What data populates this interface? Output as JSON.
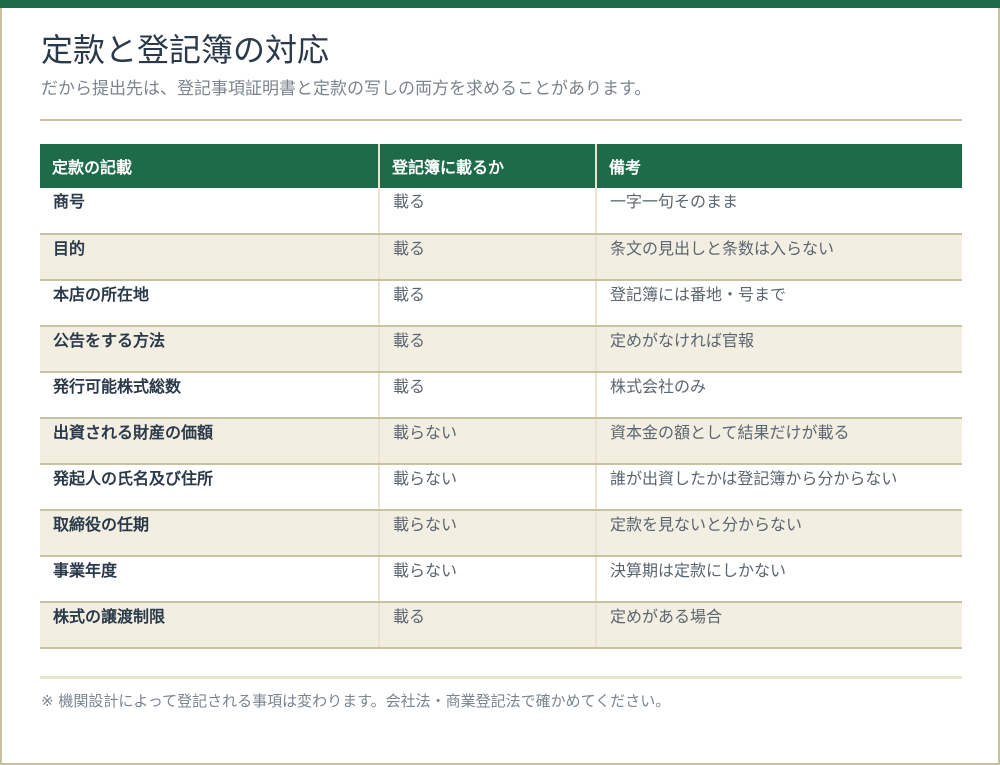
{
  "document": {
    "title": "定款と登記簿の対応",
    "subtitle": "だから提出先は、登記事項証明書と定款の写しの両方を求めることがあります。",
    "footnote": "※ 機関設計によって登記される事項は変わります。会社法・商業登記法で確かめてください。"
  },
  "colors": {
    "accent": "#1e6b4a",
    "rule": "#c8c2a0",
    "row_alt": "#f2eee2"
  },
  "table": {
    "headers": [
      "定款の記載",
      "登記簿に載るか",
      "備考"
    ],
    "rows": [
      {
        "item": "商号",
        "registered": "載る",
        "note": "一字一句そのまま"
      },
      {
        "item": "目的",
        "registered": "載る",
        "note": "条文の見出しと条数は入らない"
      },
      {
        "item": "本店の所在地",
        "registered": "載る",
        "note": "登記簿には番地・号まで"
      },
      {
        "item": "公告をする方法",
        "registered": "載る",
        "note": "定めがなければ官報"
      },
      {
        "item": "発行可能株式総数",
        "registered": "載る",
        "note": "株式会社のみ"
      },
      {
        "item": "出資される財産の価額",
        "registered": "載らない",
        "note": "資本金の額として結果だけが載る"
      },
      {
        "item": "発起人の氏名及び住所",
        "registered": "載らない",
        "note": "誰が出資したかは登記簿から分からない"
      },
      {
        "item": "取締役の任期",
        "registered": "載らない",
        "note": "定款を見ないと分からない"
      },
      {
        "item": "事業年度",
        "registered": "載らない",
        "note": "決算期は定款にしかない"
      },
      {
        "item": "株式の譲渡制限",
        "registered": "載る",
        "note": "定めがある場合"
      }
    ]
  }
}
